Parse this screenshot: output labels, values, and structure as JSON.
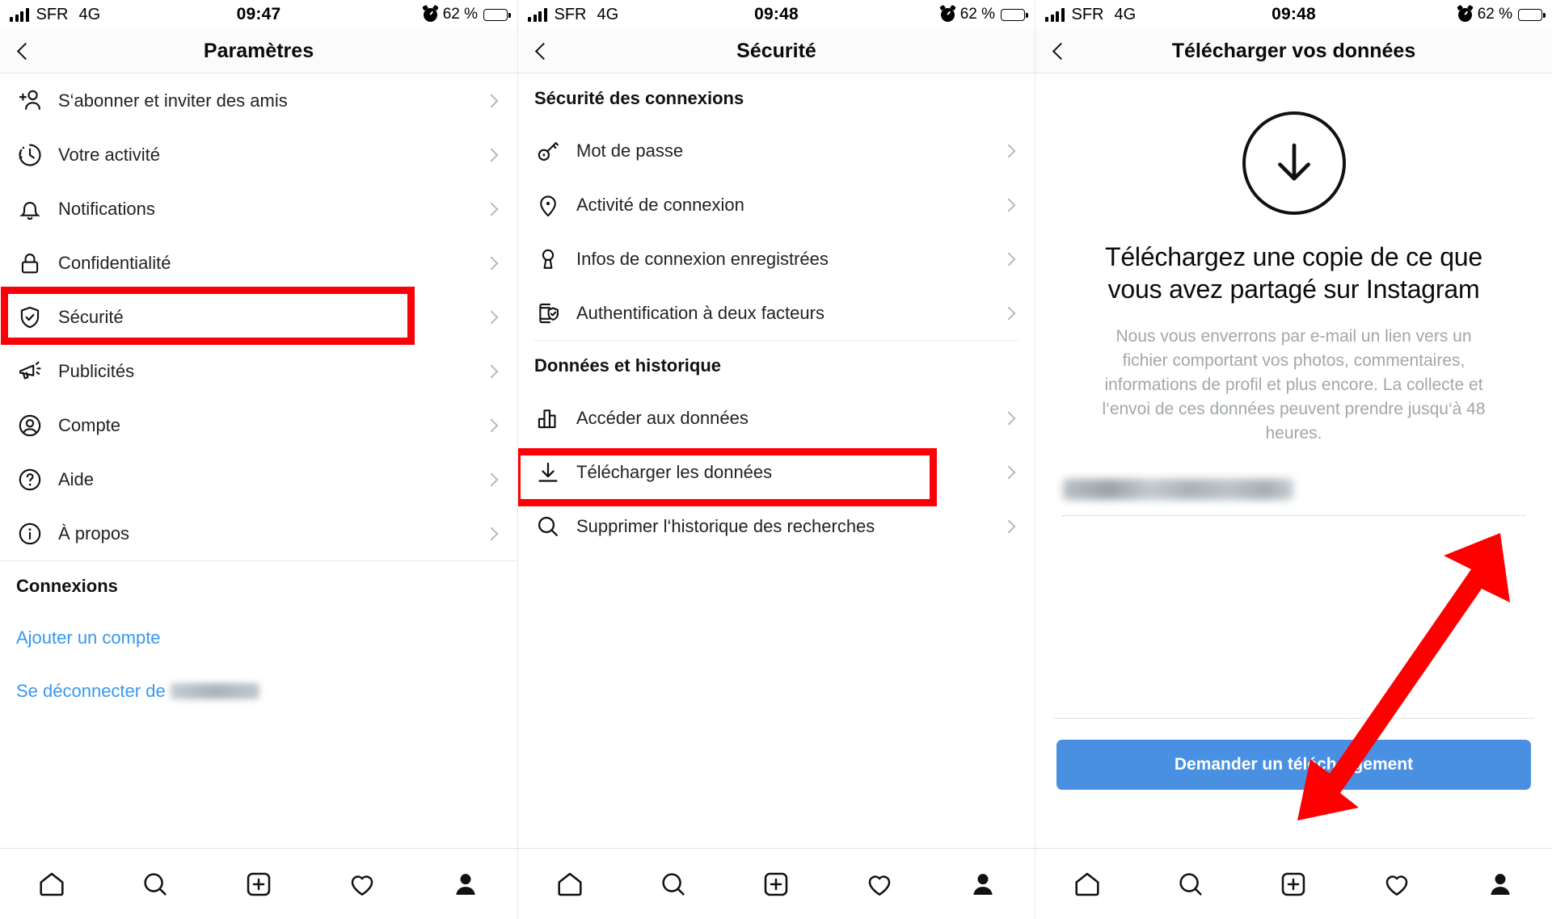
{
  "panels": [
    {
      "status": {
        "carrier": "SFR",
        "network": "4G",
        "time": "09:47",
        "battery_pct": "62 %",
        "battery_level": 62
      },
      "nav": {
        "title": "Paramètres",
        "back_icon": "chevron-left-icon"
      },
      "items": [
        {
          "label": "S‘abonner et inviter des amis",
          "icon": "person-add-icon"
        },
        {
          "label": "Votre activité",
          "icon": "activity-clock-icon"
        },
        {
          "label": "Notifications",
          "icon": "bell-icon"
        },
        {
          "label": "Confidentialité",
          "icon": "lock-icon"
        },
        {
          "label": "Sécurité",
          "icon": "shield-check-icon",
          "highlighted": true
        },
        {
          "label": "Publicités",
          "icon": "megaphone-icon"
        },
        {
          "label": "Compte",
          "icon": "account-circle-icon"
        },
        {
          "label": "Aide",
          "icon": "question-circle-icon"
        },
        {
          "label": "À propos",
          "icon": "info-circle-icon"
        }
      ],
      "connections": {
        "heading": "Connexions",
        "add_account": "Ajouter un compte",
        "logout_prefix": "Se déconnecter de"
      }
    },
    {
      "status": {
        "carrier": "SFR",
        "network": "4G",
        "time": "09:48",
        "battery_pct": "62 %",
        "battery_level": 62
      },
      "nav": {
        "title": "Sécurité",
        "back_icon": "chevron-left-icon"
      },
      "section1": "Sécurité des connexions",
      "items1": [
        {
          "label": "Mot de passe",
          "icon": "key-icon"
        },
        {
          "label": "Activité de connexion",
          "icon": "location-pin-icon"
        },
        {
          "label": "Infos de connexion enregistrées",
          "icon": "keyhole-icon"
        },
        {
          "label": "Authentification à deux facteurs",
          "icon": "phone-shield-icon"
        }
      ],
      "section2": "Données et historique",
      "items2": [
        {
          "label": "Accéder aux données",
          "icon": "bar-chart-icon"
        },
        {
          "label": "Télécharger les données",
          "icon": "download-arrow-icon",
          "highlighted": true
        },
        {
          "label": "Supprimer l‘historique des recherches",
          "icon": "search-icon"
        }
      ]
    },
    {
      "status": {
        "carrier": "SFR",
        "network": "4G",
        "time": "09:48",
        "battery_pct": "62 %",
        "battery_level": 62
      },
      "nav": {
        "title": "Télécharger vos données",
        "back_icon": "chevron-left-icon"
      },
      "hero_icon": "download-circle-icon",
      "title": "Téléchargez une copie de ce que vous avez partagé sur Instagram",
      "description": "Nous vous enverrons par e-mail un lien vers un fichier comportant vos photos, commentaires, informations de profil et plus encore. La collecte et l‘envoi de ces données peuvent prendre jusqu‘à 48 heures.",
      "email_value": "",
      "button_label": "Demander un téléchargement"
    }
  ],
  "tabbar": [
    {
      "name": "home-icon"
    },
    {
      "name": "search-icon"
    },
    {
      "name": "add-post-icon"
    },
    {
      "name": "heart-icon"
    },
    {
      "name": "profile-icon"
    }
  ],
  "annotations": {
    "highlight_color": "#fb0007",
    "arrow_color": "#ff0000",
    "accent_button_color": "#4a90e2",
    "link_color": "#3897f0"
  }
}
